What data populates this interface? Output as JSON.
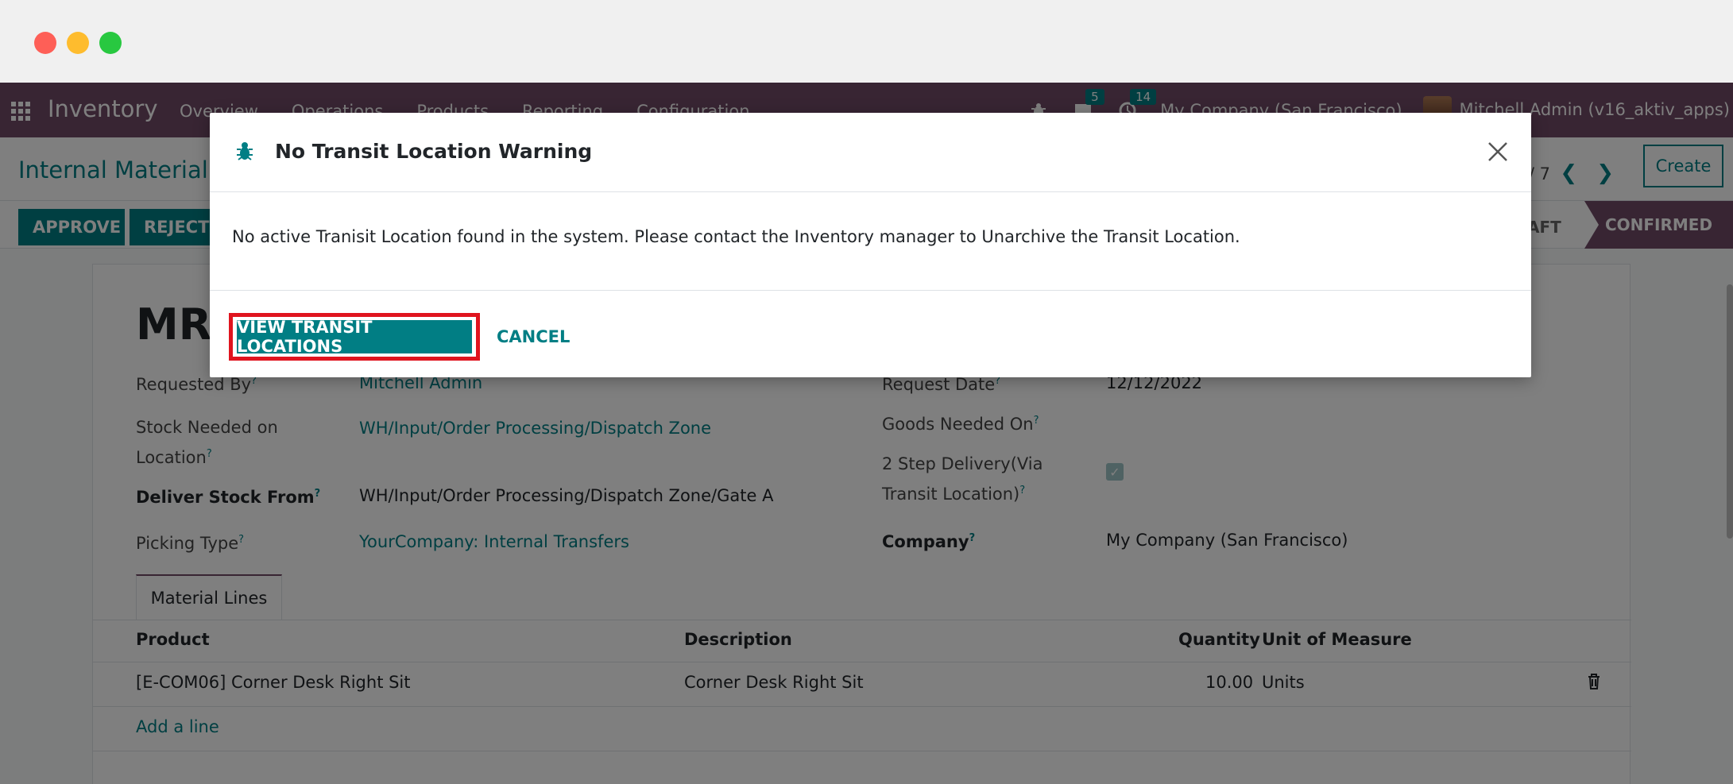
{
  "navbar": {
    "brand": "Inventory",
    "menu": [
      "Overview",
      "Operations",
      "Products",
      "Reporting",
      "Configuration"
    ],
    "messages_count": "5",
    "activities_count": "14",
    "company": "My Company (San Francisco)",
    "user": "Mitchell Admin (v16_aktiv_apps)"
  },
  "control_panel": {
    "breadcrumb": "Internal Material",
    "pager": "/ 7",
    "create_label": "Create"
  },
  "status_bar": {
    "approve_label": "APPROVE",
    "reject_label": "REJECT",
    "stage_draft": "DRAFT",
    "stage_confirmed": "CONFIRMED"
  },
  "form": {
    "record_title": "MRC",
    "requested_by_label": "Requested By",
    "requested_by_value": "Mitchell Admin",
    "stock_needed_label_1": "Stock Needed on",
    "stock_needed_label_2": "Location",
    "stock_needed_value": "WH/Input/Order Processing/Dispatch Zone",
    "deliver_from_label": "Deliver Stock From",
    "deliver_from_value": "WH/Input/Order Processing/Dispatch Zone/Gate A",
    "picking_type_label": "Picking Type",
    "picking_type_value": "YourCompany: Internal Transfers",
    "request_date_label": "Request Date",
    "request_date_value": "12/12/2022",
    "goods_needed_label": "Goods Needed On",
    "two_step_label_1": "2 Step Delivery(Via",
    "two_step_label_2": "Transit Location)",
    "two_step_checked": true,
    "company_label": "Company",
    "company_value": "My Company (San Francisco)",
    "help_mark": "?"
  },
  "tabs": {
    "material_lines": "Material Lines"
  },
  "table": {
    "columns": {
      "product": "Product",
      "description": "Description",
      "quantity": "Quantity",
      "uom": "Unit of Measure"
    },
    "rows": [
      {
        "product": "[E-COM06] Corner Desk Right Sit",
        "description": "Corner Desk Right Sit",
        "quantity": "10.00",
        "uom": "Units"
      }
    ],
    "add_line": "Add a line"
  },
  "modal": {
    "title": "No Transit Location Warning",
    "message": "No active Tranisit Location found in the system. Please contact the Inventory manager to Unarchive the Transit Location.",
    "primary_label": "VIEW TRANSIT LOCATIONS",
    "cancel_label": "CANCEL"
  },
  "colors": {
    "primary": "#017e84",
    "brand": "#714b67",
    "highlight": "#e0141e"
  }
}
